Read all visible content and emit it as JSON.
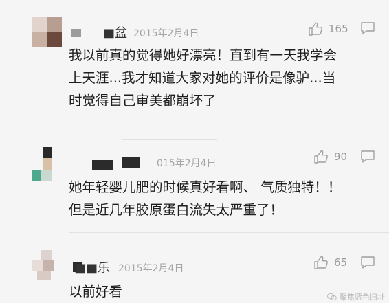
{
  "comments": [
    {
      "user": "■盆",
      "date": "2015年2月4日",
      "likes": "165",
      "text_lines": [
        "我以前真的觉得她好漂亮！直到有一天我学会",
        "上天涯...我才知道大家对她的评价是像驴...当",
        "时觉得自己审美都崩坏了"
      ]
    },
    {
      "user": "",
      "date": "015年2月4日",
      "likes": "90",
      "text_lines": [
        "她年轻婴儿肥的时候真好看啊、 气质独特！！",
        "但是近几年胶原蛋白流失太严重了！"
      ]
    },
    {
      "user": "■■乐",
      "date": "2015年2月4日",
      "likes": "65",
      "text_lines": [
        "以前好看"
      ]
    }
  ],
  "icons": {
    "like": "thumbs-up-icon",
    "reply": "comment-bubble-icon",
    "watermark": "wechat-icon"
  },
  "watermark": "聚焦蓝色旧址",
  "colors": {
    "background": "#f5f5f5",
    "meta_gray": "#a5a5a5",
    "text": "#1e1e1e"
  }
}
